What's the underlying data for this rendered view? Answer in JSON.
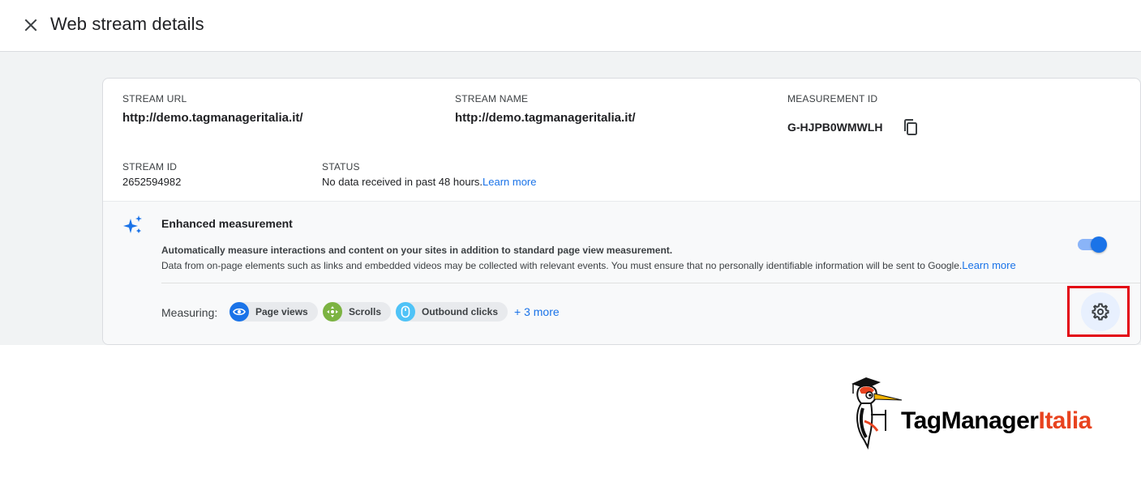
{
  "header": {
    "title": "Web stream details",
    "close_icon": "close-icon"
  },
  "stream": {
    "url_label": "STREAM URL",
    "url_value": "http://demo.tagmanageritalia.it/",
    "name_label": "STREAM NAME",
    "name_value": "http://demo.tagmanageritalia.it/",
    "measurement_label": "MEASUREMENT ID",
    "measurement_value": "G-HJPB0WMWLH",
    "id_label": "STREAM ID",
    "id_value": "2652594982",
    "status_label": "STATUS",
    "status_value": "No data received in past 48 hours.",
    "status_link": "Learn more"
  },
  "enhanced_measurement": {
    "title": "Enhanced measurement",
    "description": "Automatically measure interactions and content on your sites in addition to standard page view measurement.",
    "note": "Data from on-page elements such as links and embedded videos may be collected with relevant events. You must ensure that no personally identifiable information will be sent to Google.",
    "note_link": "Learn more",
    "toggle_on": true,
    "measuring_label": "Measuring:",
    "chips": [
      {
        "label": "Page views",
        "icon": "eye-icon",
        "color": "#1a73e8"
      },
      {
        "label": "Scrolls",
        "icon": "scroll-arrows-icon",
        "color": "#7cb342"
      },
      {
        "label": "Outbound clicks",
        "icon": "mouse-icon",
        "color": "#4fc3f7"
      }
    ],
    "more_link": "+ 3 more"
  },
  "logo": {
    "brand_part1": "TagManager",
    "brand_part2": "Italia",
    "color_part1": "#000000",
    "color_part2": "#e8431f"
  },
  "colors": {
    "accent": "#1a73e8",
    "highlight": "#e30613",
    "background_gray": "#f1f3f4"
  }
}
